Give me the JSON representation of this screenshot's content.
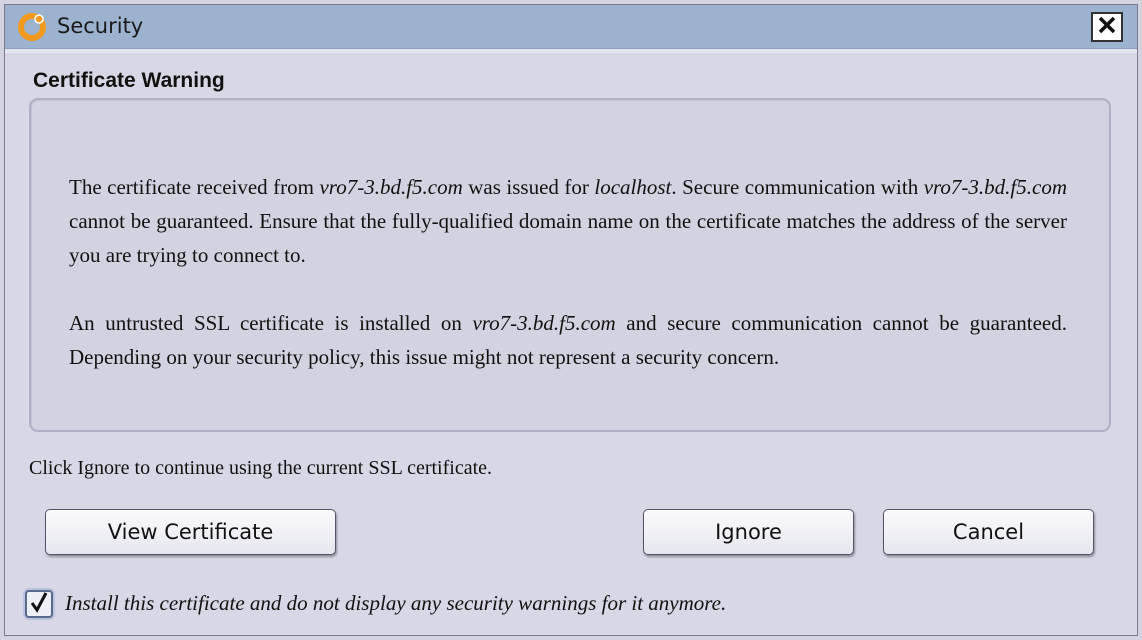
{
  "window": {
    "title": "Security",
    "close_label": "X"
  },
  "dialog": {
    "heading": "Certificate Warning",
    "message1": {
      "t1": "The certificate received from ",
      "host1": "vro7-3.bd.f5.com",
      "t2": " was issued for ",
      "issued_for": "localhost",
      "t3": ". Secure communication with ",
      "host2": "vro7-3.bd.f5.com",
      "t4": " cannot be guaranteed. Ensure that the fully-qualified domain name on the certificate matches the address of the server you are trying to connect to."
    },
    "message2": {
      "t1": "An untrusted SSL certificate is installed on ",
      "host": "vro7-3.bd.f5.com",
      "t2": " and secure communication cannot be guaranteed. Depending on your security policy, this issue might not represent a security concern."
    },
    "instruction": "Click Ignore to continue using the current SSL certificate.",
    "buttons": {
      "view_certificate": "View Certificate",
      "ignore": "Ignore",
      "cancel": "Cancel"
    },
    "checkbox": {
      "checked": true,
      "label": "Install this certificate and do not display any security warnings for it anymore."
    }
  },
  "colors": {
    "titlebar": "#9cb2cf",
    "window_bg": "#d7d7e5",
    "app_icon": "#f29a1f"
  },
  "icons": {
    "app": "orchestrator-logo-icon",
    "close": "close-icon",
    "check": "checkmark-icon"
  }
}
